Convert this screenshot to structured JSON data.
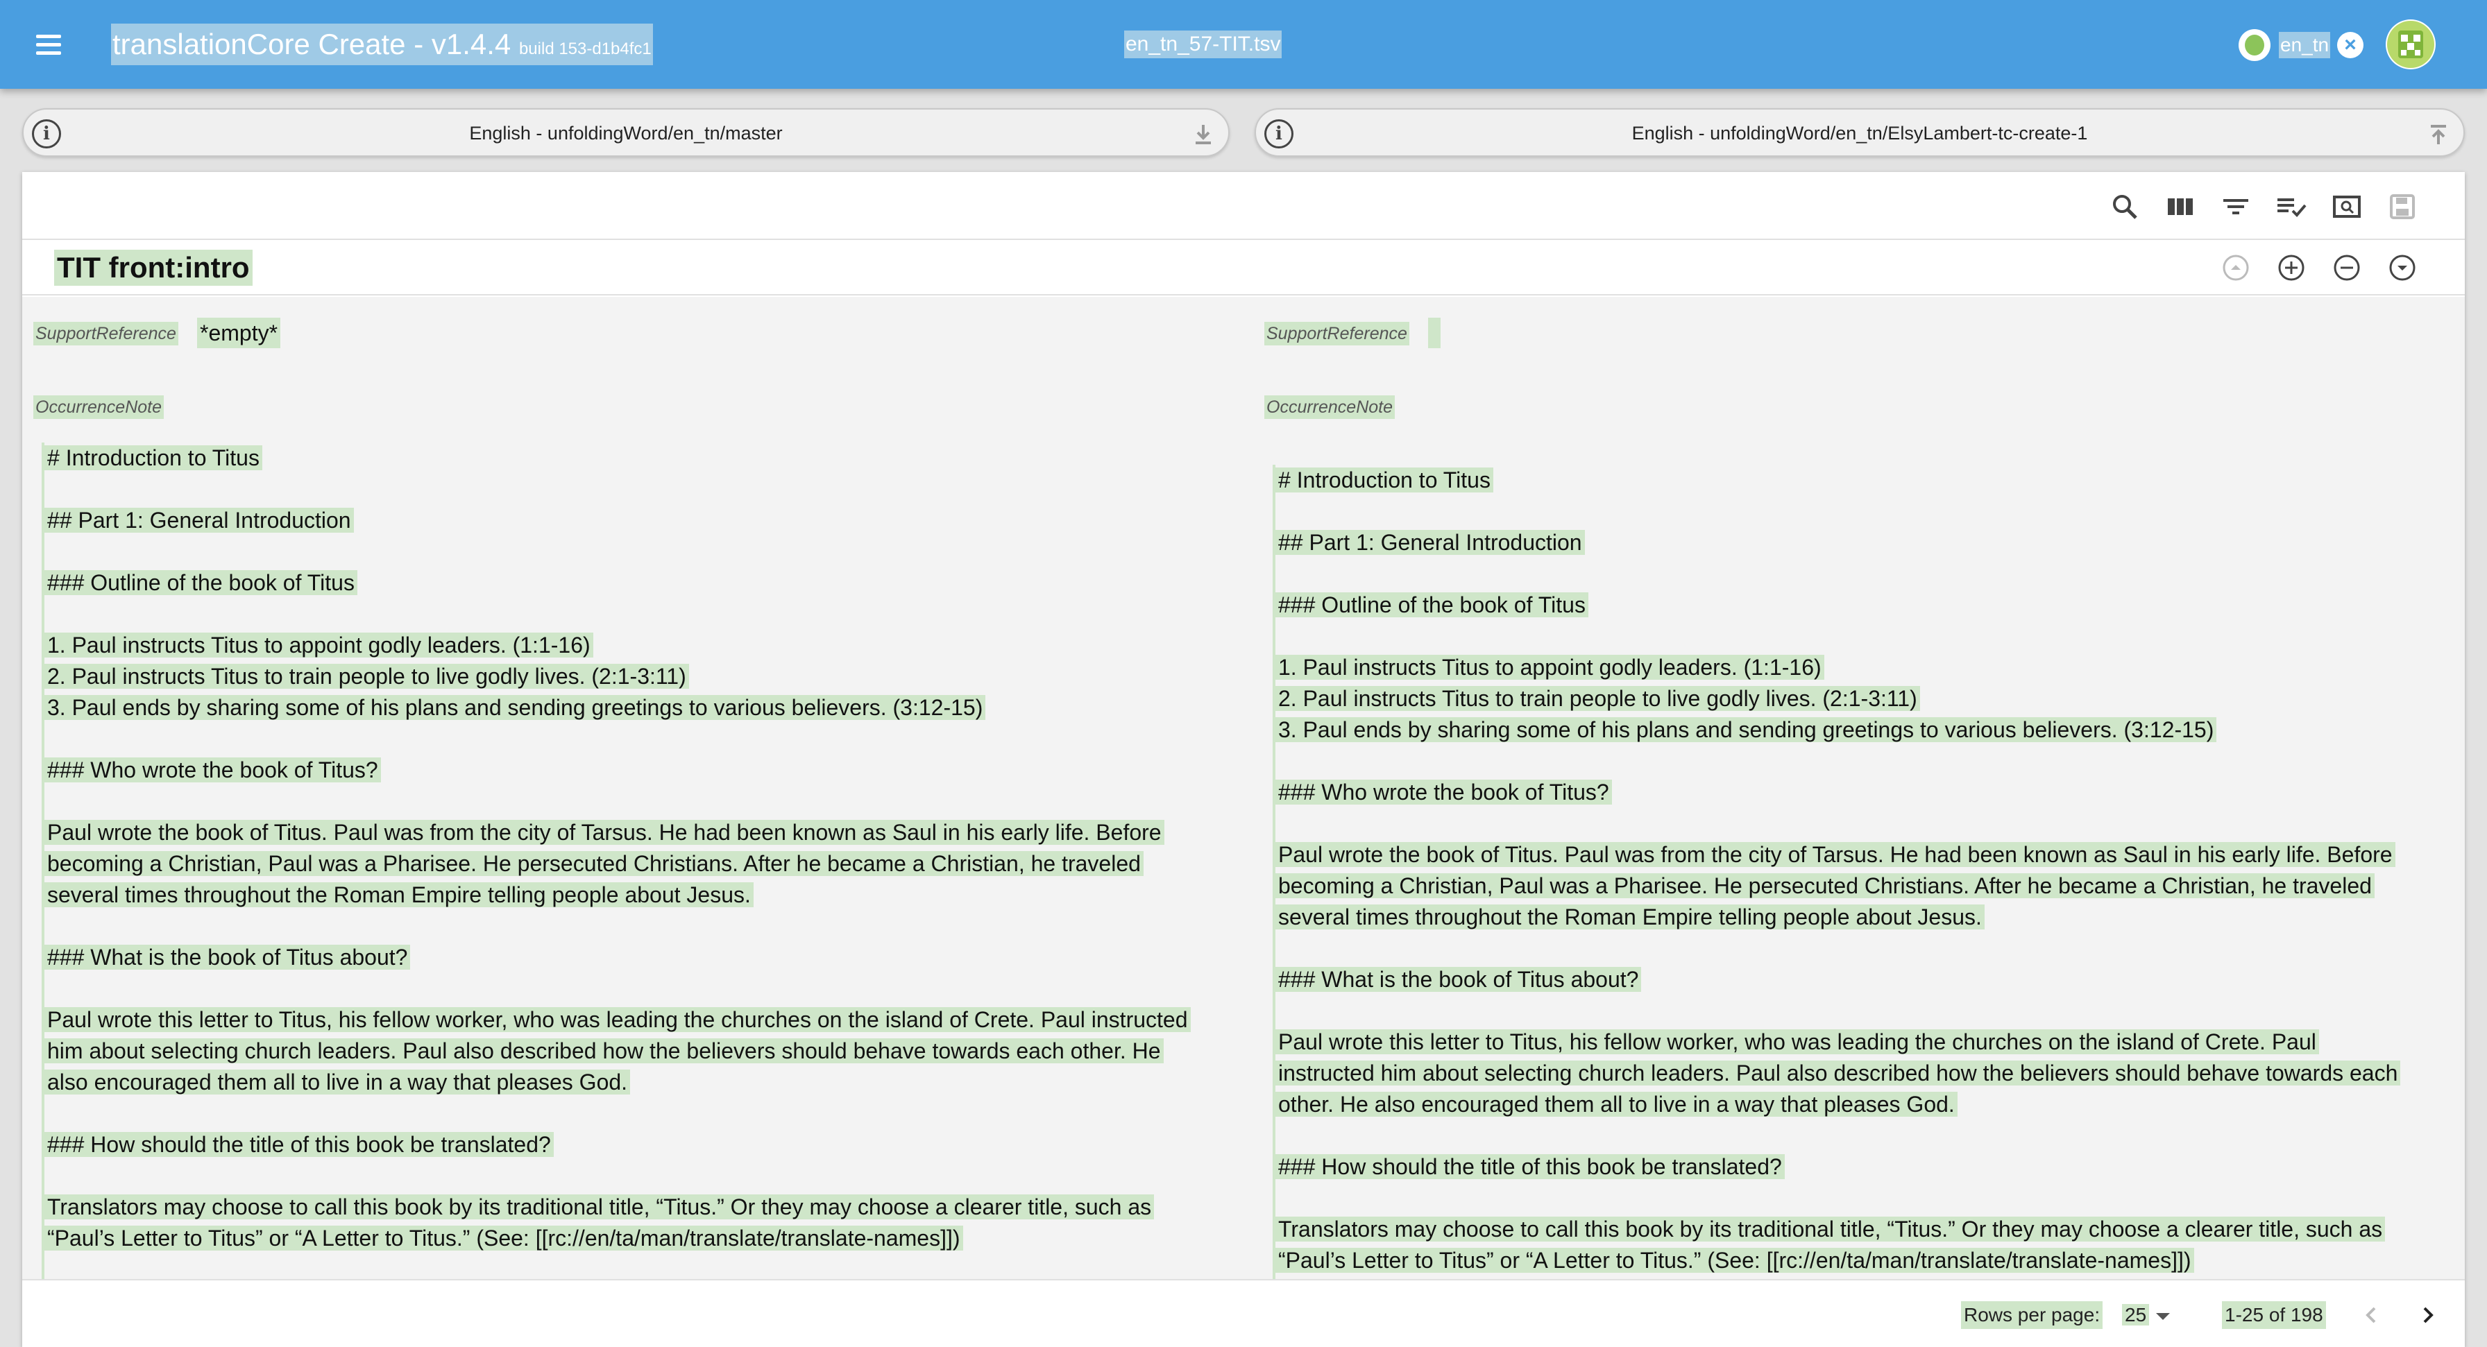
{
  "app": {
    "title": "translationCore Create - v1.4.4",
    "build": "build 153-d1b4fc1",
    "file_name": "en_tn_57-TIT.tsv",
    "language": "en_tn",
    "icons": {
      "menu": "menu-icon",
      "close": "close-icon",
      "avatar": "user-avatar-icon"
    }
  },
  "resources": {
    "left": {
      "label": "English - unfoldingWord/en_tn/master",
      "icon": "download-icon"
    },
    "right": {
      "label": "English - unfoldingWord/en_tn/ElsyLambert-tc-create-1",
      "icon": "upload-icon"
    }
  },
  "row": {
    "title": "TIT front:intro",
    "support_reference_label": "SupportReference",
    "occurrence_note_label": "OccurrenceNote",
    "left_support_reference": "*empty*",
    "right_support_reference": ""
  },
  "left_note": [
    [
      "# Introduction to Titus"
    ],
    [
      "## Part 1: General Introduction"
    ],
    [
      "### Outline of the book of Titus"
    ],
    [
      "1. Paul instructs Titus to appoint godly leaders. (1:1-16)",
      "2. Paul instructs Titus to train people to live godly lives. (2:1-3:11)",
      "3. Paul ends by sharing some of his plans and sending greetings to various believers. (3:12-15)"
    ],
    [
      "### Who wrote the book of Titus?"
    ],
    [
      "Paul wrote the book of Titus. Paul was from the city of Tarsus. He had been known as Saul in his early life. Before",
      "becoming a Christian, Paul was a Pharisee. He persecuted Christians. After he became a Christian, he traveled",
      "several times throughout the Roman Empire telling people about Jesus."
    ],
    [
      "### What is the book of Titus about?"
    ],
    [
      "Paul wrote this letter to Titus, his fellow worker, who was leading the churches on the island of Crete. Paul instructed",
      "him about selecting church leaders. Paul also described how the believers should behave towards each other. He",
      "also encouraged them all to live in a way that pleases God."
    ],
    [
      "### How should the title of this book be translated?"
    ],
    [
      "Translators may choose to call this book by its traditional title, “Titus.” Or they may choose a clearer title, such as",
      "“Paul’s Letter to Titus” or “A Letter to Titus.” (See: [[rc://en/ta/man/translate/translate-names]])"
    ]
  ],
  "right_note": [
    [
      "# Introduction to Titus"
    ],
    [
      "## Part 1: General Introduction"
    ],
    [
      "### Outline of the book of Titus"
    ],
    [
      "1. Paul instructs Titus to appoint godly leaders. (1:1-16)",
      "2. Paul instructs Titus to train people to live godly lives. (2:1-3:11)",
      "3. Paul ends by sharing some of his plans and sending greetings to various believers. (3:12-15)"
    ],
    [
      "### Who wrote the book of Titus?"
    ],
    [
      "Paul wrote the book of Titus. Paul was from the city of Tarsus. He had been known as Saul in his early life. Before",
      "becoming a Christian, Paul was a Pharisee. He persecuted Christians. After he became a Christian, he traveled",
      "several times throughout the Roman Empire telling people about Jesus."
    ],
    [
      "### What is the book of Titus about?"
    ],
    [
      "Paul wrote this letter to Titus, his fellow worker, who was leading the churches on the island of Crete. Paul",
      "instructed him about selecting church leaders. Paul also described how the believers should behave towards each",
      "other. He also encouraged them all to live in a way that pleases God."
    ],
    [
      "### How should the title of this book be translated?"
    ],
    [
      "Translators may choose to call this book by its traditional title, “Titus.” Or they may choose a clearer title, such as",
      "“Paul’s Letter to Titus” or “A Letter to Titus.” (See: [[rc://en/ta/man/translate/translate-names]])"
    ]
  ],
  "toolbar": {
    "icons": [
      "search-icon",
      "view-columns-icon",
      "filter-icon",
      "playlist-check-icon",
      "preview-icon",
      "save-icon"
    ]
  },
  "row_nav_icons": [
    "expand-up-icon",
    "add-row-icon",
    "remove-row-icon",
    "expand-down-icon"
  ],
  "footer": {
    "rows_per_page_label": "Rows per page:",
    "rows_per_page": "25",
    "range": "1-25 of 198",
    "icons": {
      "prev": "chevron-left-icon",
      "next": "chevron-right-icon"
    }
  },
  "colors": {
    "appbar": "#4a9ee0",
    "highlight": "#cfe6c9",
    "panel": "#ffffff",
    "content_bg": "#f3f3f3"
  }
}
